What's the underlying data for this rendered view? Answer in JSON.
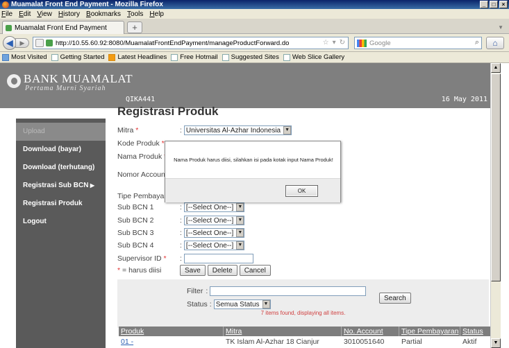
{
  "window": {
    "title": "Muamalat Front End Payment - Mozilla Firefox",
    "controls": [
      "_",
      "×"
    ]
  },
  "menu": [
    "File",
    "Edit",
    "View",
    "History",
    "Bookmarks",
    "Tools",
    "Help"
  ],
  "tab": {
    "label": "Muamalat Front End Payment",
    "new_tab": "+"
  },
  "nav": {
    "url": "http://10.55.60.92:8080/MuamalatFrontEndPayment/manageProductForward.do",
    "search_placeholder": "Google"
  },
  "bookmarks": [
    "Most Visited",
    "Getting Started",
    "Latest Headlines",
    "Free Hotmail",
    "Suggested Sites",
    "Web Slice Gallery"
  ],
  "header": {
    "bank_name": "BANK MUAMALAT",
    "tagline": "Pertama Murni Syariah",
    "user_code": "QIKA441",
    "date": "16 May 2011"
  },
  "sidebar": {
    "items": [
      {
        "label": "Upload"
      },
      {
        "label": "Download (bayar)"
      },
      {
        "label": "Download (terhutang)"
      },
      {
        "label": "Registrasi Sub BCN",
        "submenu": true
      },
      {
        "label": "Registrasi Produk"
      },
      {
        "label": "Logout"
      }
    ]
  },
  "form": {
    "title": "Registrasi Produk",
    "mitra_label": "Mitra",
    "mitra_value": "Universitas Al-Azhar Indonesia",
    "kode_produk_label": "Kode Produk",
    "nama_produk_label": "Nama Produk",
    "nomor_account_label": "Nomor Account",
    "tipe_pembayaran_label": "Tipe Pembayaran",
    "sub_bcn_1_label": "Sub BCN 1",
    "sub_bcn_2_label": "Sub BCN 2",
    "sub_bcn_3_label": "Sub BCN 3",
    "sub_bcn_4_label": "Sub BCN 4",
    "select_one": "[--Select One--]",
    "supervisor_label": "Supervisor ID",
    "required_note": "= harus diisi",
    "required_mark": "*",
    "save": "Save",
    "delete": "Delete",
    "cancel": "Cancel"
  },
  "filter": {
    "filter_label": "Filter",
    "status_label": "Status",
    "status_value": "Semua Status",
    "search": "Search"
  },
  "results": {
    "count_text": "7 items found, displaying all items.",
    "columns": [
      "Produk",
      "Mitra",
      "No. Account",
      "Tipe Pembayaran",
      "Status"
    ],
    "rows": [
      {
        "produk": "01 -",
        "mitra": "TK Islam Al-Azhar 18 Cianjur",
        "account": "3010051640",
        "tipe": "Partial",
        "status": "Aktif"
      }
    ]
  },
  "dialog": {
    "message": "Nama Produk harus diisi, silahkan isi pada kotak input Nama Produk!",
    "ok": "OK"
  }
}
